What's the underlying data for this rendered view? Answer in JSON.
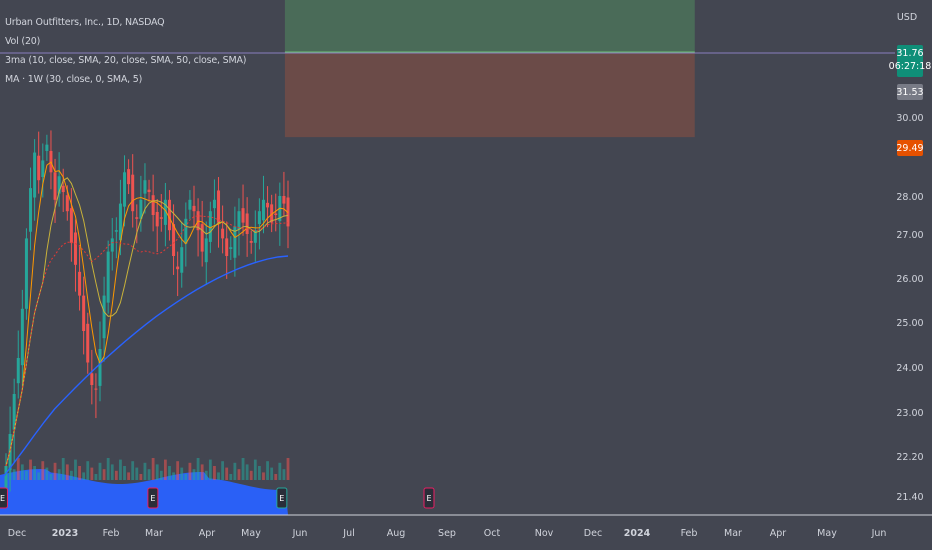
{
  "legend": {
    "symbol": "Urban Outfitters, Inc., 1D, NASDAQ",
    "volume": "Vol (20)",
    "ma3": "3ma (10, close, SMA, 20, close, SMA, 50, close, SMA)",
    "ma_weekly": "MA · 1W (30, close, 0, SMA, 5)"
  },
  "price_scale": {
    "currency": "USD",
    "last_price": "31.76",
    "countdown": "06:27:18",
    "prev_price": "31.53",
    "stop_price": "29.49"
  },
  "colors": {
    "background": "#434651",
    "up_candle": "#26a69a",
    "down_candle": "#ef5350",
    "volume_area": "#2962ff",
    "ma_blue": "#2962ff",
    "ma_orange": "#ff9800",
    "ma_yellow": "#c9b23a",
    "ma_red": "#e53935",
    "profit_zone": "#4a6b58",
    "loss_zone": "#6b4b48",
    "last_price_tag": "#0f8f78",
    "stop_tag": "#e65100",
    "earnings_marker": "#e91e63"
  },
  "chart_data": {
    "type": "candlestick",
    "title": "Urban Outfitters, Inc., 1D, NASDAQ",
    "y_axis_ticks": [
      "21.40",
      "22.20",
      "23.00",
      "24.00",
      "25.00",
      "26.00",
      "27.00",
      "28.00",
      "30.00"
    ],
    "x_axis_ticks": [
      "Dec",
      "2023",
      "Feb",
      "Mar",
      "Apr",
      "May",
      "Jun",
      "Jul",
      "Aug",
      "Sep",
      "Oct",
      "Nov",
      "Dec",
      "2024",
      "Feb",
      "Mar",
      "Apr",
      "May",
      "Jun"
    ],
    "x_axis_bold": [
      "2023",
      "2024"
    ],
    "price_range": [
      21.1,
      32.9
    ],
    "data_range": [
      "2022-11-23",
      "2023-05-25"
    ],
    "approx_closes": [
      22.0,
      22.6,
      23.4,
      24.2,
      25.3,
      26.9,
      28.2,
      29.1,
      28.4,
      28.9,
      29.3,
      28.6,
      27.9,
      28.5,
      28.1,
      27.6,
      26.8,
      26.3,
      25.6,
      24.8,
      24.1,
      23.6,
      23.5,
      24.4,
      25.6,
      26.6,
      26.9,
      27.1,
      27.8,
      28.6,
      28.3,
      27.6,
      27.4,
      27.9,
      28.4,
      28.1,
      27.5,
      27.2,
      27.4,
      27.9,
      27.1,
      26.5,
      26.2,
      26.7,
      27.4,
      27.9,
      27.6,
      27.1,
      26.6,
      26.9,
      27.6,
      27.9,
      27.3,
      26.9,
      26.5,
      26.7,
      27.2,
      27.6,
      27.3,
      27.0,
      26.8,
      27.1,
      27.6,
      27.9,
      27.7,
      27.3,
      27.5,
      28.0,
      27.8,
      27.2
    ],
    "moving_average_1w_30": {
      "start": 21.8,
      "end": 26.5
    },
    "position": {
      "entry": 31.53,
      "target": 32.9,
      "stop": 29.49,
      "start": "2023-05-25",
      "end": "2024-02-16"
    },
    "earnings_events": [
      "2022-11-22",
      "2023-02-28",
      "2023-05-23",
      "2023-08-22"
    ]
  }
}
